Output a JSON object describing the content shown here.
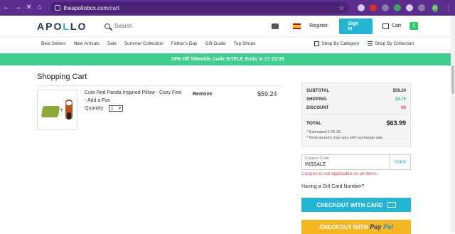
{
  "browser": {
    "url_domain": "theapollobox.com",
    "url_path": "/cart",
    "profile_initial": "m"
  },
  "header": {
    "logo": "APOLLO",
    "search_placeholder": "Search",
    "register": "Register",
    "signin": "Sign in",
    "cart_label": "Cart",
    "cart_count": "1"
  },
  "nav": {
    "items": [
      "Best Sellers",
      "New Arrivals",
      "Sale",
      "Summer Collection",
      "Father's Day",
      "Gift Guide",
      "Top Shops"
    ],
    "shop_by_category": "Shop By Category",
    "shop_by_collection": "Shop By Collection"
  },
  "promo": "15% Off Sitewide Code SITELE Ends in 17:23:25",
  "cart": {
    "title": "Shopping Cart",
    "item": {
      "name": "Cute Red Panda Inspired Pillow - Cozy Feel - Add a Fun",
      "quantity_label": "Quantity",
      "quantity": "1",
      "remove": "Remove",
      "price": "$59.24"
    }
  },
  "summary": {
    "subtotal_label": "SUBTOTAL",
    "subtotal": "$59.24",
    "shipping_label": "SHIPPING",
    "shipping": "$4.75",
    "discount_label": "DISCOUNT",
    "discount": "-$0",
    "total_label": "TOTAL",
    "total": "$63.99",
    "estimated": "* Estimated € 65.26.",
    "note": "* Final amount may vary with exchange rate."
  },
  "coupon": {
    "label": "Coupon Code",
    "value": "INSSALE",
    "apply": "Apply",
    "error": "Coupon is not applicable on all items."
  },
  "gift_card": "Having a Gift Card Number?",
  "checkout_card": "CHECKOUT WITH CARD",
  "checkout_paypal_prefix": "CHECKOUT WITH",
  "paypal_pay": "Pay",
  "paypal_pal": "Pal",
  "colors": {
    "accent": "#23b5d3",
    "promo": "#3ecf8e",
    "paypal": "#f5b722",
    "error": "#e74c3c"
  }
}
